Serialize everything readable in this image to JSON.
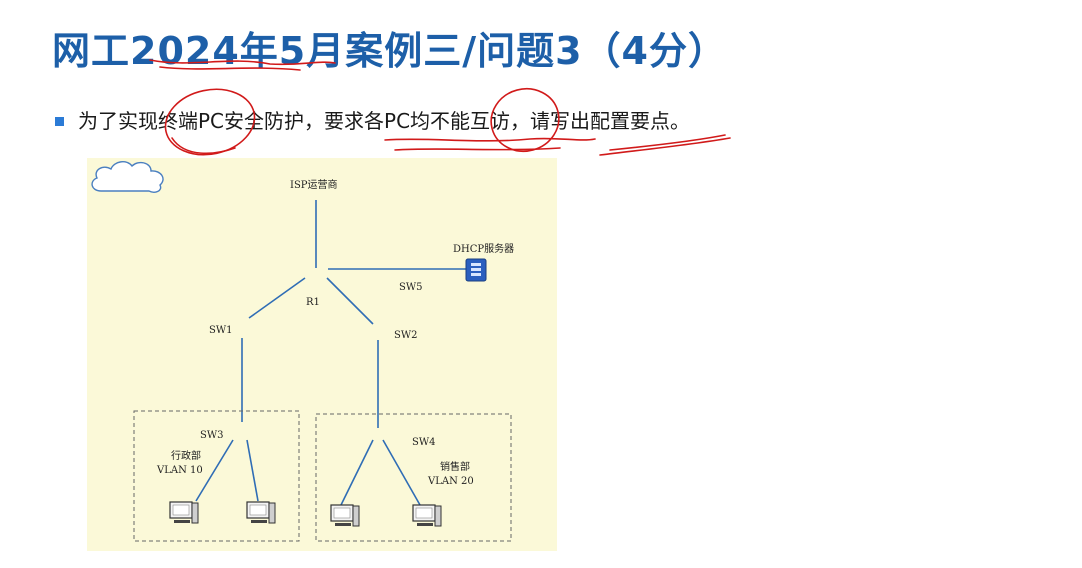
{
  "title": "网工2024年5月案例三/问题3（4分）",
  "bullet": "为了实现终端PC安全防护，要求各PC均不能互访，请写出配置要点。",
  "diagram": {
    "isp": "ISP运营商",
    "dhcp": "DHCP服务器",
    "r1": "R1",
    "sw1": "SW1",
    "sw2": "SW2",
    "sw3": "SW3",
    "sw4": "SW4",
    "sw5": "SW5",
    "dept_admin": {
      "name": "行政部",
      "vlan": "VLAN 10"
    },
    "dept_sales": {
      "name": "销售部",
      "vlan": "VLAN 20"
    }
  },
  "colors": {
    "title": "#1d5fa8",
    "bullet_marker": "#2b7bd6",
    "diagram_bg": "#fbf9d8",
    "link": "#2f6db5",
    "annotation": "#d11a1a"
  },
  "icons": [
    "cloud-icon",
    "server-icon",
    "pc-icon"
  ]
}
